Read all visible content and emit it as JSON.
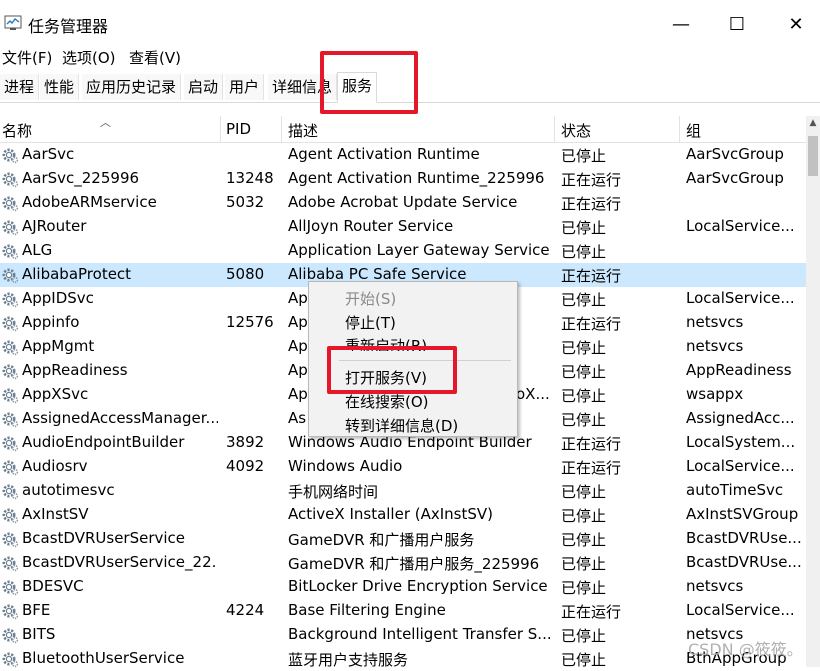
{
  "window": {
    "title": "任务管理器",
    "minimize_glyph": "—",
    "maximize_glyph": "☐",
    "close_glyph": "✕"
  },
  "menu": [
    "文件(F)",
    "选项(O)",
    "查看(V)"
  ],
  "tabs": [
    "进程",
    "性能",
    "应用历史记录",
    "启动",
    "用户",
    "详细信息",
    "服务"
  ],
  "active_tab": "服务",
  "columns": [
    "名称",
    "PID",
    "描述",
    "状态",
    "组"
  ],
  "services": [
    {
      "name": "AarSvc",
      "pid": "",
      "desc": "Agent Activation Runtime",
      "status": "已停止",
      "group": "AarSvcGroup"
    },
    {
      "name": "AarSvc_225996",
      "pid": "13248",
      "desc": "Agent Activation Runtime_225996",
      "status": "正在运行",
      "group": "AarSvcGroup"
    },
    {
      "name": "AdobeARMservice",
      "pid": "5032",
      "desc": "Adobe Acrobat Update Service",
      "status": "正在运行",
      "group": ""
    },
    {
      "name": "AJRouter",
      "pid": "",
      "desc": "AllJoyn Router Service",
      "status": "已停止",
      "group": "LocalService..."
    },
    {
      "name": "ALG",
      "pid": "",
      "desc": "Application Layer Gateway Service",
      "status": "已停止",
      "group": ""
    },
    {
      "name": "AlibabaProtect",
      "pid": "5080",
      "desc": "Alibaba PC Safe Service",
      "status": "正在运行",
      "group": ""
    },
    {
      "name": "AppIDSvc",
      "pid": "",
      "desc": "Ap",
      "status": "已停止",
      "group": "LocalService..."
    },
    {
      "name": "Appinfo",
      "pid": "12576",
      "desc": "Ap",
      "status": "正在运行",
      "group": "netsvcs"
    },
    {
      "name": "AppMgmt",
      "pid": "",
      "desc": "Ap",
      "status": "已停止",
      "group": "netsvcs"
    },
    {
      "name": "AppReadiness",
      "pid": "",
      "desc": "Ap",
      "status": "已停止",
      "group": "AppReadiness"
    },
    {
      "name": "AppXSvc",
      "pid": "",
      "desc": "Ap",
      "desc_tail": "oX...",
      "status": "已停止",
      "group": "wsappx"
    },
    {
      "name": "AssignedAccessManager...",
      "pid": "",
      "desc": "As",
      "status": "已停止",
      "group": "AssignedAcc..."
    },
    {
      "name": "AudioEndpointBuilder",
      "pid": "3892",
      "desc": "Windows Audio Endpoint Builder",
      "status": "正在运行",
      "group": "LocalSystem..."
    },
    {
      "name": "Audiosrv",
      "pid": "4092",
      "desc": "Windows Audio",
      "status": "正在运行",
      "group": "LocalService..."
    },
    {
      "name": "autotimesvc",
      "pid": "",
      "desc": "手机网络时间",
      "status": "已停止",
      "group": "autoTimeSvc"
    },
    {
      "name": "AxInstSV",
      "pid": "",
      "desc": "ActiveX Installer (AxInstSV)",
      "status": "已停止",
      "group": "AxInstSVGroup"
    },
    {
      "name": "BcastDVRUserService",
      "pid": "",
      "desc": "GameDVR 和广播用户服务",
      "status": "已停止",
      "group": "BcastDVRUse..."
    },
    {
      "name": "BcastDVRUserService_22...",
      "pid": "",
      "desc": "GameDVR 和广播用户服务_225996",
      "status": "已停止",
      "group": "BcastDVRUse..."
    },
    {
      "name": "BDESVC",
      "pid": "",
      "desc": "BitLocker Drive Encryption Service",
      "status": "已停止",
      "group": "netsvcs"
    },
    {
      "name": "BFE",
      "pid": "4224",
      "desc": "Base Filtering Engine",
      "status": "正在运行",
      "group": "LocalService..."
    },
    {
      "name": "BITS",
      "pid": "",
      "desc": "Background Intelligent Transfer S...",
      "status": "已停止",
      "group": "netsvcs"
    },
    {
      "name": "BluetoothUserService",
      "pid": "",
      "desc": "蓝牙用户支持服务",
      "status": "已停止",
      "group": "BthAppGroup"
    }
  ],
  "selected_row": "AlibabaProtect",
  "context_menu": {
    "start": "开始(S)",
    "stop": "停止(T)",
    "restart": "重新启动(R)",
    "open_services": "打开服务(V)",
    "search_online": "在线搜索(O)",
    "go_to_details": "转到详细信息(D)"
  },
  "watermark": "CSDN @筱筱。",
  "colors": {
    "highlight": "#e5182a",
    "selection": "#cce8ff"
  }
}
